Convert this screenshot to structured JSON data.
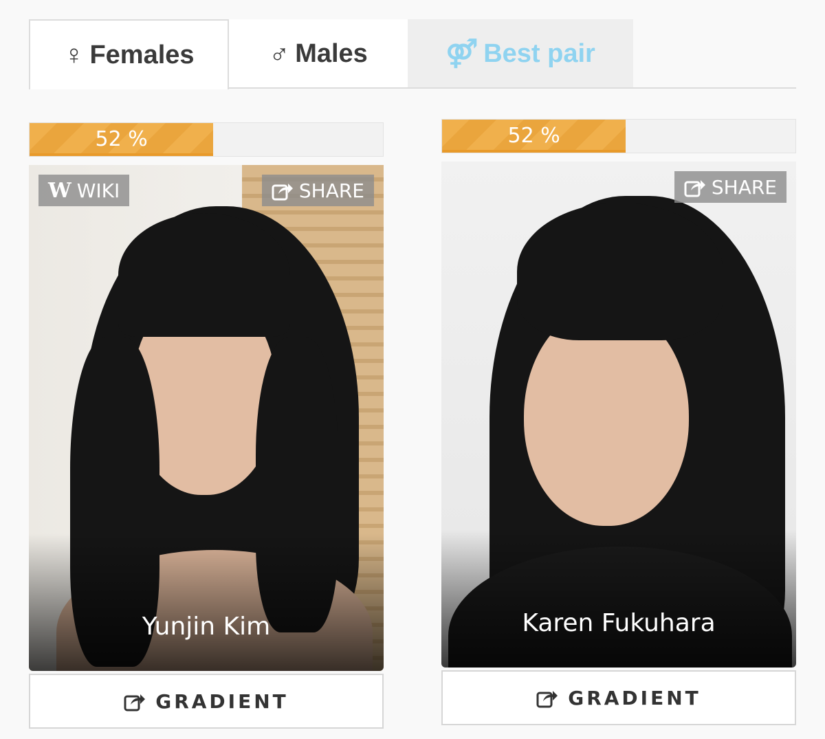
{
  "tabs": [
    {
      "symbol": "♀",
      "label": "Females",
      "active": true
    },
    {
      "symbol": "♂",
      "label": "Males",
      "active": false
    },
    {
      "symbol": "⚤",
      "label": "Best pair",
      "active": false
    }
  ],
  "colors": {
    "progress": "#f0b04c",
    "best_pair_text": "#8fd3f0",
    "overlay_button": "#8c8c8c"
  },
  "cards": [
    {
      "progress_text": "52 %",
      "progress_fraction": 0.52,
      "wiki_label": "WIKI",
      "share_label": "SHARE",
      "name": "Yunjin Kim",
      "gradient_label": "GRADIENT"
    },
    {
      "progress_text": "52 %",
      "progress_fraction": 0.52,
      "share_label": "SHARE",
      "name": "Karen Fukuhara",
      "gradient_label": "GRADIENT"
    }
  ]
}
